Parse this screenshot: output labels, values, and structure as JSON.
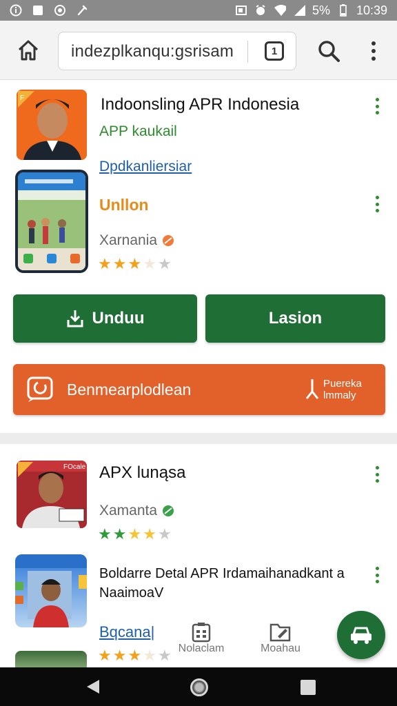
{
  "status_bar": {
    "battery": "5%",
    "time": "10:39"
  },
  "toolbar": {
    "url": "indezplkanqu:gsrisam",
    "tab_count": "1"
  },
  "card1": {
    "title": "Indoonsling APR Indonesia",
    "subtitle": "APP kaukail",
    "link": "Dpdkanliersiar",
    "orange_label": "Unllon",
    "category": "Xarnania",
    "rating": 2.5,
    "buttons": {
      "download": "Unduu",
      "secondary": "Lasion"
    },
    "banner": {
      "text": "Benmearplodlean",
      "right_line1": "Puereka",
      "right_line2": "lmmaly"
    },
    "icon_badge": "F"
  },
  "card2": {
    "title": "APX lunąsa",
    "category": "Xamanta",
    "rating": 4,
    "description": "Boldarre Detal APR Irdamaihanadkant a NaaimoaV",
    "link": "Bqcana|",
    "rating2": 3,
    "icon_banner": "FOcale",
    "mini_tab_1": "Nolaclam",
    "mini_tab_2": "Moahau"
  },
  "colors": {
    "green": "#1f6e35",
    "orange": "#e2602a",
    "link": "#1f5fa8"
  }
}
